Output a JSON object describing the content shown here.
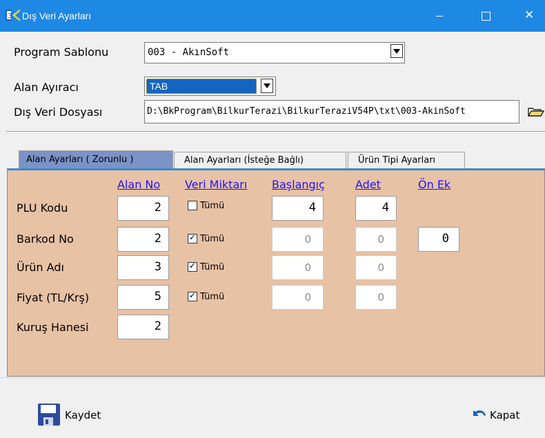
{
  "window": {
    "title": "Dış Veri Ayarları",
    "minimize_icon": "minimize-icon",
    "maximize_icon": "maximize-icon",
    "close_glyph": "✕"
  },
  "form": {
    "program_label": "Program Sablonu",
    "program_value": "003 - AkınSoft",
    "separator_label": "Alan Ayıracı",
    "separator_value": "TAB",
    "file_label": "Dış Veri Dosyası",
    "file_value": "D:\\BkProgram\\BilkurTerazi\\BilkurTeraziV54P\\txt\\003-AkinSoft"
  },
  "tabs": [
    {
      "label": "Alan Ayarları ( Zorunlu )",
      "active": true
    },
    {
      "label": "Alan Ayarları (İsteğe Bağlı)",
      "active": false
    },
    {
      "label": "Ürün Tipi Ayarları",
      "active": false
    }
  ],
  "columns": {
    "alan_no": "Alan No",
    "veri_miktari": "Veri Miktarı",
    "baslangic": "Başlangıç",
    "adet": "Adet",
    "on_ek": "Ön Ek"
  },
  "rows": [
    {
      "label": "PLU Kodu",
      "alan_no": "2",
      "tumu_label": "Tümü",
      "tumu_checked": false,
      "baslangic": "4",
      "adet": "4",
      "enabled": true
    },
    {
      "label": "Barkod No",
      "alan_no": "2",
      "tumu_label": "Tümü",
      "tumu_checked": true,
      "baslangic": "0",
      "adet": "0",
      "on_ek": "0",
      "enabled": false
    },
    {
      "label": "Ürün Adı",
      "alan_no": "3",
      "tumu_label": "Tümü",
      "tumu_checked": true,
      "baslangic": "0",
      "adet": "0",
      "enabled": false
    },
    {
      "label": "Fiyat (TL/Krş)",
      "alan_no": "5",
      "tumu_label": "Tümü",
      "tumu_checked": true,
      "baslangic": "0",
      "adet": "0",
      "enabled": false
    },
    {
      "label": "Kuruş Hanesi",
      "alan_no": "2"
    }
  ],
  "buttons": {
    "save_label": "Kaydet",
    "close_label": "Kapat"
  },
  "colors": {
    "titlebar": "#1e88e5",
    "panel": "#e8c2a5",
    "active_tab": "#7b93c7",
    "link_header": "#1c12ff"
  }
}
